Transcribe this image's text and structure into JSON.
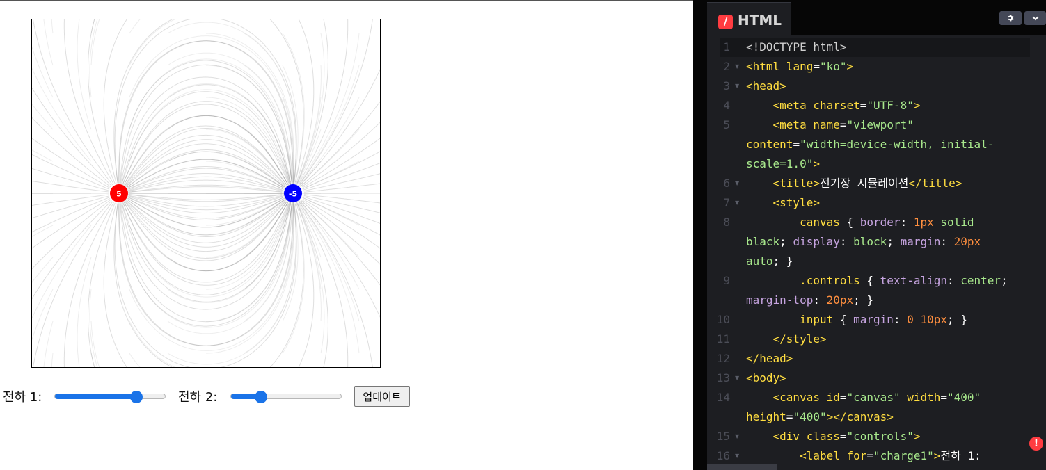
{
  "preview": {
    "charges": [
      {
        "value_label": "5",
        "color": "#ff0000"
      },
      {
        "value_label": "-5",
        "color": "#0000ff"
      }
    ],
    "controls": {
      "charge1_label": "전하 1:",
      "charge1_slider_fraction": 0.73,
      "charge2_label": "전하 2:",
      "charge2_slider_fraction": 0.27,
      "update_button": "업데이트"
    }
  },
  "editor": {
    "tab_title": "HTML",
    "tab_icon": "codepen-html-icon",
    "settings_icon": "gear-icon",
    "collapse_icon": "chevron-down-icon",
    "error_icon": "!",
    "colors": {
      "background": "#1d1e22",
      "accent": "#ff3c41",
      "string": "#a8e88c",
      "tag": "#ffdd40"
    },
    "lines": [
      {
        "n": "1",
        "fold": false,
        "rows": [
          [
            [
              "t-doc",
              "<!DOCTYPE html>"
            ]
          ]
        ]
      },
      {
        "n": "2",
        "fold": true,
        "rows": [
          [
            [
              "t-tag",
              "<html"
            ],
            [
              "t-attr",
              " lang"
            ],
            [
              "t-plain",
              "="
            ],
            [
              "t-str",
              "\"ko\""
            ],
            [
              "t-tag",
              ">"
            ]
          ]
        ]
      },
      {
        "n": "3",
        "fold": true,
        "rows": [
          [
            [
              "t-tag",
              "<head>"
            ]
          ]
        ]
      },
      {
        "n": "4",
        "fold": false,
        "rows": [
          [
            [
              "t-plain",
              "    "
            ],
            [
              "t-tag",
              "<meta"
            ],
            [
              "t-attr",
              " charset"
            ],
            [
              "t-plain",
              "="
            ],
            [
              "t-str",
              "\"UTF-8\""
            ],
            [
              "t-tag",
              ">"
            ]
          ]
        ]
      },
      {
        "n": "5",
        "fold": false,
        "rows": [
          [
            [
              "t-plain",
              "    "
            ],
            [
              "t-tag",
              "<meta"
            ],
            [
              "t-attr",
              " name"
            ],
            [
              "t-plain",
              "="
            ],
            [
              "t-str",
              "\"viewport\""
            ]
          ],
          [
            [
              "t-attr",
              "content"
            ],
            [
              "t-plain",
              "="
            ],
            [
              "t-str",
              "\"width=device-width, initial-"
            ]
          ],
          [
            [
              "t-str",
              "scale=1.0\""
            ],
            [
              "t-tag",
              ">"
            ]
          ]
        ]
      },
      {
        "n": "6",
        "fold": true,
        "rows": [
          [
            [
              "t-plain",
              "    "
            ],
            [
              "t-tag",
              "<title>"
            ],
            [
              "t-plain",
              "전기장 시뮬레이션"
            ],
            [
              "t-tag",
              "</title>"
            ]
          ]
        ]
      },
      {
        "n": "7",
        "fold": true,
        "rows": [
          [
            [
              "t-plain",
              "    "
            ],
            [
              "t-tag",
              "<style>"
            ]
          ]
        ]
      },
      {
        "n": "8",
        "fold": false,
        "rows": [
          [
            [
              "t-plain",
              "        "
            ],
            [
              "t-kw",
              "canvas"
            ],
            [
              "t-plain",
              " { "
            ],
            [
              "t-prop",
              "border"
            ],
            [
              "t-plain",
              ": "
            ],
            [
              "t-num",
              "1px"
            ],
            [
              "t-str",
              " solid"
            ]
          ],
          [
            [
              "t-str",
              "black"
            ],
            [
              "t-plain",
              "; "
            ],
            [
              "t-prop",
              "display"
            ],
            [
              "t-plain",
              ": "
            ],
            [
              "t-str",
              "block"
            ],
            [
              "t-plain",
              "; "
            ],
            [
              "t-prop",
              "margin"
            ],
            [
              "t-plain",
              ": "
            ],
            [
              "t-num",
              "20px"
            ]
          ],
          [
            [
              "t-str",
              "auto"
            ],
            [
              "t-plain",
              "; }"
            ]
          ]
        ]
      },
      {
        "n": "9",
        "fold": false,
        "rows": [
          [
            [
              "t-plain",
              "        "
            ],
            [
              "t-kw",
              ".controls"
            ],
            [
              "t-plain",
              " { "
            ],
            [
              "t-prop",
              "text-align"
            ],
            [
              "t-plain",
              ": "
            ],
            [
              "t-str",
              "center"
            ],
            [
              "t-plain",
              ";"
            ]
          ],
          [
            [
              "t-prop",
              "margin-top"
            ],
            [
              "t-plain",
              ": "
            ],
            [
              "t-num",
              "20px"
            ],
            [
              "t-plain",
              "; }"
            ]
          ]
        ]
      },
      {
        "n": "10",
        "fold": false,
        "rows": [
          [
            [
              "t-plain",
              "        "
            ],
            [
              "t-kw",
              "input"
            ],
            [
              "t-plain",
              " { "
            ],
            [
              "t-prop",
              "margin"
            ],
            [
              "t-plain",
              ": "
            ],
            [
              "t-num",
              "0"
            ],
            [
              "t-plain",
              " "
            ],
            [
              "t-num",
              "10px"
            ],
            [
              "t-plain",
              "; }"
            ]
          ]
        ]
      },
      {
        "n": "11",
        "fold": false,
        "rows": [
          [
            [
              "t-plain",
              "    "
            ],
            [
              "t-tag",
              "</style>"
            ]
          ]
        ]
      },
      {
        "n": "12",
        "fold": false,
        "rows": [
          [
            [
              "t-tag",
              "</head>"
            ]
          ]
        ]
      },
      {
        "n": "13",
        "fold": true,
        "rows": [
          [
            [
              "t-tag",
              "<body>"
            ]
          ]
        ]
      },
      {
        "n": "14",
        "fold": false,
        "rows": [
          [
            [
              "t-plain",
              "    "
            ],
            [
              "t-tag",
              "<canvas"
            ],
            [
              "t-attr",
              " id"
            ],
            [
              "t-plain",
              "="
            ],
            [
              "t-str",
              "\"canvas\""
            ],
            [
              "t-attr",
              " width"
            ],
            [
              "t-plain",
              "="
            ],
            [
              "t-str",
              "\"400\""
            ]
          ],
          [
            [
              "t-attr",
              "height"
            ],
            [
              "t-plain",
              "="
            ],
            [
              "t-str",
              "\"400\""
            ],
            [
              "t-tag",
              "></canvas>"
            ]
          ]
        ]
      },
      {
        "n": "15",
        "fold": true,
        "rows": [
          [
            [
              "t-plain",
              "    "
            ],
            [
              "t-tag",
              "<div"
            ],
            [
              "t-attr",
              " class"
            ],
            [
              "t-plain",
              "="
            ],
            [
              "t-str",
              "\"controls\""
            ],
            [
              "t-tag",
              ">"
            ]
          ]
        ]
      },
      {
        "n": "16",
        "fold": true,
        "rows": [
          [
            [
              "t-plain",
              "        "
            ],
            [
              "t-tag",
              "<label"
            ],
            [
              "t-attr",
              " for"
            ],
            [
              "t-plain",
              "="
            ],
            [
              "t-str",
              "\"charge1\""
            ],
            [
              "t-tag",
              ">"
            ],
            [
              "t-plain",
              "전하 1:"
            ]
          ]
        ]
      }
    ]
  }
}
